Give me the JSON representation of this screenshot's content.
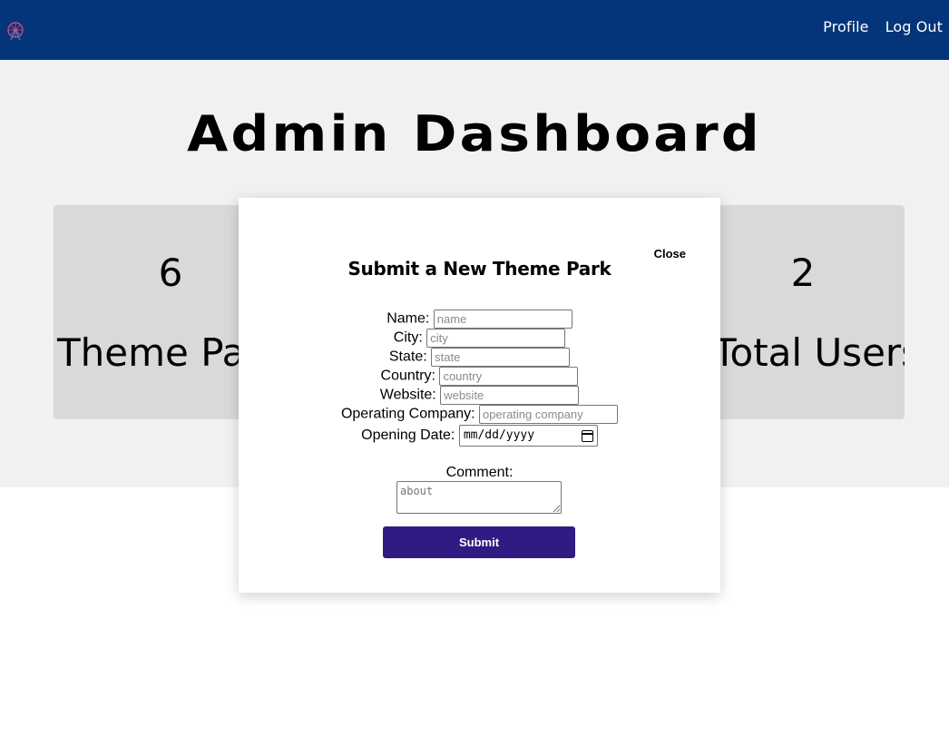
{
  "nav": {
    "logo": "ferris-wheel-logo",
    "profile_label": "Profile",
    "logout_label": "Log Out"
  },
  "page": {
    "title": "Admin Dashboard"
  },
  "stats": [
    {
      "value": "6",
      "label": "Theme Par"
    },
    {
      "value": "2",
      "label": "Total Users"
    }
  ],
  "modal": {
    "title": "Submit a New Theme Park",
    "close_label": "Close",
    "fields": {
      "name": {
        "label": "Name:",
        "placeholder": "name"
      },
      "city": {
        "label": "City:",
        "placeholder": "city"
      },
      "state": {
        "label": "State:",
        "placeholder": "state"
      },
      "country": {
        "label": "Country:",
        "placeholder": "country"
      },
      "website": {
        "label": "Website:",
        "placeholder": "website"
      },
      "company": {
        "label": "Operating Company:",
        "placeholder": "operating company"
      },
      "opening_date": {
        "label": "Opening Date:",
        "placeholder": "mm/dd/yyyy"
      }
    },
    "comment": {
      "label": "Comment:",
      "placeholder": "about"
    },
    "submit_label": "Submit"
  },
  "colors": {
    "navbar": "#043479",
    "hero_bg": "#f1f1f1",
    "card_bg": "#d9d9d9",
    "submit_bg": "#311b82"
  }
}
